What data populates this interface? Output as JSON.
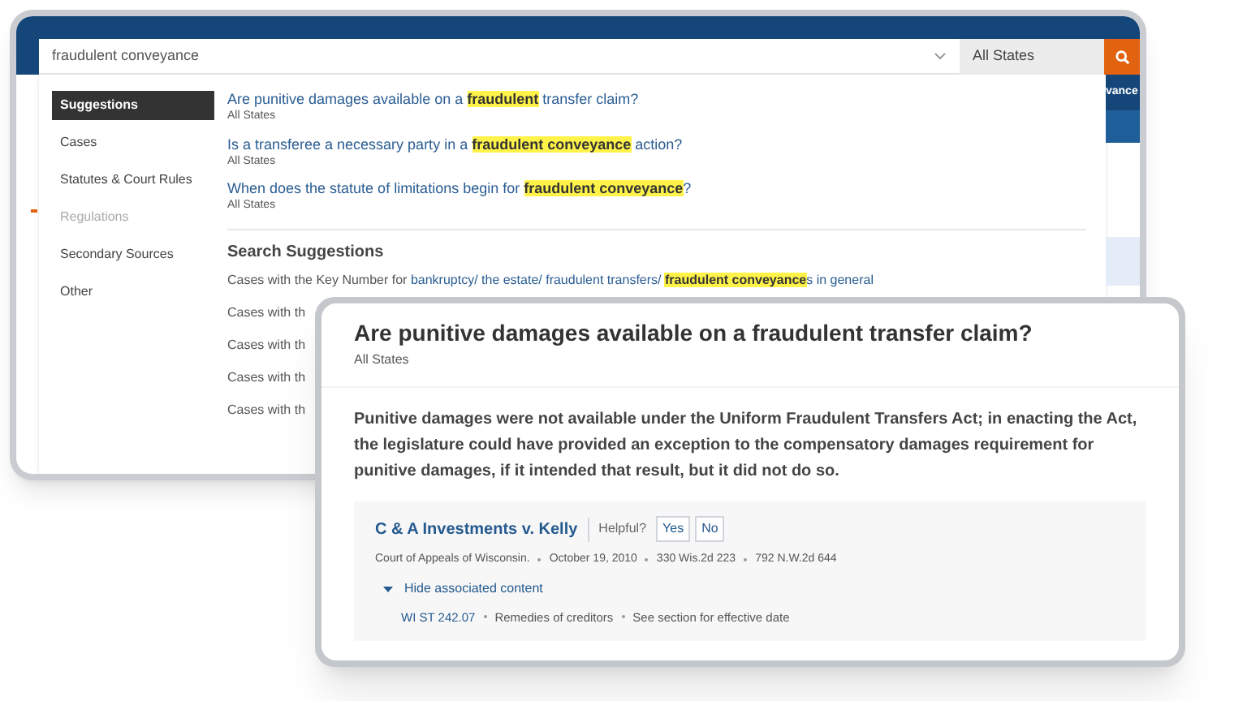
{
  "search": {
    "query": "fraudulent conveyance",
    "state": "All States",
    "advanced_label": "vance"
  },
  "categories": [
    {
      "label": "Suggestions",
      "selected": true,
      "disabled": false
    },
    {
      "label": "Cases",
      "selected": false,
      "disabled": false
    },
    {
      "label": "Statutes & Court Rules",
      "selected": false,
      "disabled": false
    },
    {
      "label": "Regulations",
      "selected": false,
      "disabled": true
    },
    {
      "label": "Secondary Sources",
      "selected": false,
      "disabled": false
    },
    {
      "label": "Other",
      "selected": false,
      "disabled": false
    }
  ],
  "questions": [
    {
      "segments": [
        {
          "kind": "link",
          "text": "Are punitive damages available on a "
        },
        {
          "kind": "highlight",
          "text": "fraudulent"
        },
        {
          "kind": "link",
          "text": " transfer claim?"
        }
      ],
      "jurisdiction": "All States"
    },
    {
      "segments": [
        {
          "kind": "link",
          "text": "Is a transferee a necessary party in a "
        },
        {
          "kind": "highlight",
          "text": "fraudulent conveyance"
        },
        {
          "kind": "link",
          "text": " action?"
        }
      ],
      "jurisdiction": "All States"
    },
    {
      "segments": [
        {
          "kind": "link",
          "text": "When does the statute of limitations begin for "
        },
        {
          "kind": "highlight",
          "text": "fraudulent conveyance"
        },
        {
          "kind": "link",
          "text": "?"
        }
      ],
      "jurisdiction": "All States"
    }
  ],
  "search_suggestions": {
    "heading": "Search Suggestions",
    "items": [
      {
        "segments": [
          {
            "kind": "plain",
            "text": "Cases with the Key Number for "
          },
          {
            "kind": "link",
            "text": "bankruptcy/ the estate/ fraudulent transfers/ "
          },
          {
            "kind": "highlight",
            "text": "fraudulent conveyance"
          },
          {
            "kind": "link",
            "text": "s in general"
          }
        ]
      },
      {
        "segments": [
          {
            "kind": "plain",
            "text": "Cases with th"
          }
        ]
      },
      {
        "segments": [
          {
            "kind": "plain",
            "text": "Cases with th"
          }
        ]
      },
      {
        "segments": [
          {
            "kind": "plain",
            "text": "Cases with th"
          }
        ]
      },
      {
        "segments": [
          {
            "kind": "plain",
            "text": "Cases with th"
          }
        ]
      }
    ]
  },
  "answer_card": {
    "title": "Are punitive damages available on a fraudulent transfer claim?",
    "jurisdiction": "All States",
    "answer": "Punitive damages were not available under the Uniform Fraudulent Transfers Act; in enacting the Act, the legislature could have provided an exception to the compensatory damages requirement for punitive damages, if it intended that result, but it did not do so.",
    "case": {
      "name": "C & A Investments v. Kelly",
      "helpful_label": "Helpful?",
      "buttons": [
        "Yes",
        "No"
      ],
      "meta": [
        "Court of Appeals of Wisconsin.",
        "October 19, 2010",
        "330 Wis.2d 223",
        "792 N.W.2d 644"
      ],
      "toggle": {
        "label": "Hide associated content",
        "expanded": true
      },
      "associated": [
        {
          "kind": "link",
          "text": "WI ST 242.07"
        },
        {
          "kind": "plain",
          "text": "Remedies of creditors"
        },
        {
          "kind": "plain",
          "text": "See section for effective date"
        }
      ]
    }
  }
}
